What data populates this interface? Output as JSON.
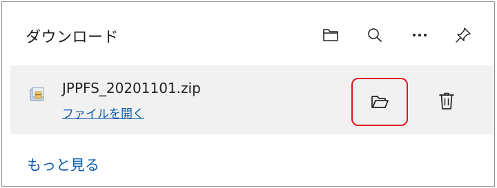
{
  "header": {
    "title": "ダウンロード",
    "icons": [
      "folder-icon",
      "search-icon",
      "more-options-icon",
      "pin-icon"
    ]
  },
  "download_item": {
    "file_name": "JPPFS_20201101.zip",
    "open_file_label": "ファイルを開く",
    "file_icon": "zip-file-icon",
    "actions": [
      "open-folder-icon",
      "trash-icon"
    ],
    "highlight_color": "#e3141b"
  },
  "footer": {
    "more_label": "もっと見る"
  },
  "colors": {
    "link": "#0b5cad",
    "item_background": "#f1f1f1",
    "border": "#8a8a8a"
  }
}
